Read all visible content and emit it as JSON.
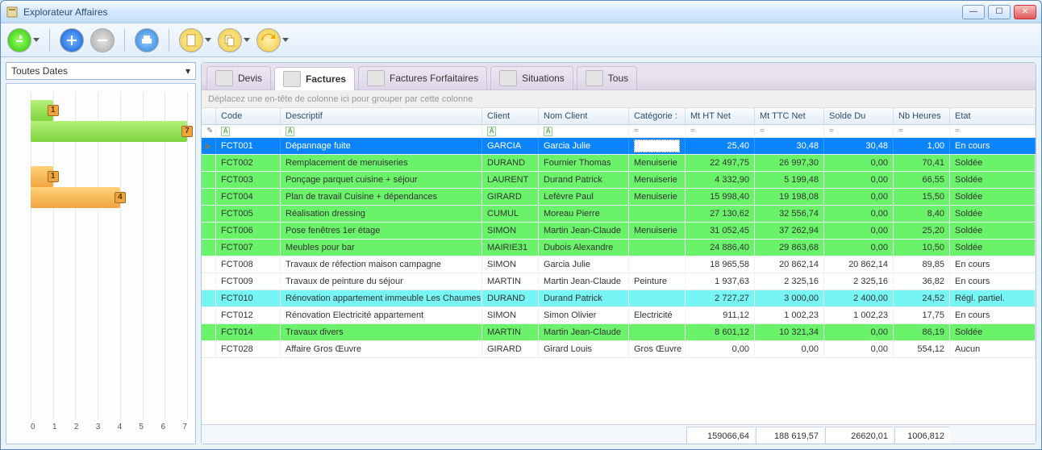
{
  "window": {
    "title": "Explorateur Affaires"
  },
  "date_filter": {
    "label": "Toutes Dates"
  },
  "chart_data": {
    "type": "bar",
    "xlim": [
      0,
      7
    ],
    "ticks": [
      "0",
      "1",
      "2",
      "3",
      "4",
      "5",
      "6",
      "7"
    ],
    "series": [
      {
        "name": "green-1",
        "value": 1,
        "label": "1"
      },
      {
        "name": "green-2",
        "value": 7,
        "label": "7"
      },
      {
        "name": "orange-1",
        "value": 1,
        "label": "1"
      },
      {
        "name": "orange-2",
        "value": 4,
        "label": "4"
      }
    ]
  },
  "tabs": [
    {
      "id": "devis",
      "label": "Devis"
    },
    {
      "id": "factures",
      "label": "Factures"
    },
    {
      "id": "forfait",
      "label": "Factures Forfaitaires"
    },
    {
      "id": "situations",
      "label": "Situations"
    },
    {
      "id": "tous",
      "label": "Tous"
    }
  ],
  "group_hint": "Déplacez une en-tête de colonne ici pour grouper par cette colonne",
  "columns": {
    "code": "Code",
    "descriptif": "Descriptif",
    "client": "Client",
    "nom_client": "Nom Client",
    "categorie": "Catégorie :",
    "ht": "Mt HT Net",
    "ttc": "Mt TTC Net",
    "solde": "Solde Du",
    "heures": "Nb Heures",
    "etat": "Etat"
  },
  "filter_glyph_text": "A",
  "filter_glyph_eq": "=",
  "rows": [
    {
      "sel": true,
      "st": "selected",
      "code": "FCT001",
      "desc": "Dépannage fuite",
      "client": "GARCIA",
      "nom": "Garcia Julie",
      "cat": "",
      "ht": "25,40",
      "ttc": "30,48",
      "solde": "30,48",
      "h": "1,00",
      "etat": "En cours",
      "cat_edit": true
    },
    {
      "st": "green",
      "code": "FCT002",
      "desc": "Remplacement de menuiseries",
      "client": "DURAND",
      "nom": "Fournier Thomas",
      "cat": "Menuiserie",
      "ht": "22 497,75",
      "ttc": "26 997,30",
      "solde": "0,00",
      "h": "70,41",
      "etat": "Soldée"
    },
    {
      "st": "green",
      "code": "FCT003",
      "desc": "Ponçage parquet cuisine + séjour",
      "client": "LAURENT",
      "nom": "Durand Patrick",
      "cat": "Menuiserie",
      "ht": "4 332,90",
      "ttc": "5 199,48",
      "solde": "0,00",
      "h": "66,55",
      "etat": "Soldée"
    },
    {
      "st": "green",
      "code": "FCT004",
      "desc": "Plan de travail Cuisine + dépendances",
      "client": "GIRARD",
      "nom": "Lefèvre Paul",
      "cat": "Menuiserie",
      "ht": "15 998,40",
      "ttc": "19 198,08",
      "solde": "0,00",
      "h": "15,50",
      "etat": "Soldée"
    },
    {
      "st": "green",
      "code": "FCT005",
      "desc": "Réalisation dressing",
      "client": "CUMUL",
      "nom": "Moreau Pierre",
      "cat": "",
      "ht": "27 130,62",
      "ttc": "32 556,74",
      "solde": "0,00",
      "h": "8,40",
      "etat": "Soldée"
    },
    {
      "st": "green",
      "code": "FCT006",
      "desc": "Pose fenêtres 1er étage",
      "client": "SIMON",
      "nom": "Martin Jean-Claude",
      "cat": "Menuiserie",
      "ht": "31 052,45",
      "ttc": "37 262,94",
      "solde": "0,00",
      "h": "25,20",
      "etat": "Soldée"
    },
    {
      "st": "green",
      "code": "FCT007",
      "desc": "Meubles pour bar",
      "client": "MAIRIE31",
      "nom": "Dubois Alexandre",
      "cat": "",
      "ht": "24 886,40",
      "ttc": "29 863,68",
      "solde": "0,00",
      "h": "10,50",
      "etat": "Soldée"
    },
    {
      "st": "white",
      "code": "FCT008",
      "desc": "Travaux de réfection maison campagne",
      "client": "SIMON",
      "nom": "Garcia Julie",
      "cat": "",
      "ht": "18 965,58",
      "ttc": "20 862,14",
      "solde": "20 862,14",
      "h": "89,85",
      "etat": "En cours"
    },
    {
      "st": "white",
      "code": "FCT009",
      "desc": "Travaux de peinture du séjour",
      "client": "MARTIN",
      "nom": "Martin Jean-Claude",
      "cat": "Peinture",
      "ht": "1 937,63",
      "ttc": "2 325,16",
      "solde": "2 325,16",
      "h": "36,82",
      "etat": "En cours"
    },
    {
      "st": "cyan",
      "code": "FCT010",
      "desc": "Rénovation appartement immeuble Les Chaumes",
      "client": "DURAND",
      "nom": "Durand Patrick",
      "cat": "",
      "ht": "2 727,27",
      "ttc": "3 000,00",
      "solde": "2 400,00",
      "h": "24,52",
      "etat": "Régl. partiel."
    },
    {
      "st": "white",
      "code": "FCT012",
      "desc": "Rénovation Electricité appartement",
      "client": "SIMON",
      "nom": "Simon Olivier",
      "cat": "Electricité",
      "ht": "911,12",
      "ttc": "1 002,23",
      "solde": "1 002,23",
      "h": "17,75",
      "etat": "En cours"
    },
    {
      "st": "green",
      "code": "FCT014",
      "desc": "Travaux divers",
      "client": "MARTIN",
      "nom": "Martin Jean-Claude",
      "cat": "",
      "ht": "8 601,12",
      "ttc": "10 321,34",
      "solde": "0,00",
      "h": "86,19",
      "etat": "Soldée"
    },
    {
      "st": "white",
      "code": "FCT028",
      "desc": "Affaire Gros Œuvre",
      "client": "GIRARD",
      "nom": "Girard Louis",
      "cat": "Gros Œuvre",
      "ht": "0,00",
      "ttc": "0,00",
      "solde": "0,00",
      "h": "554,12",
      "etat": "Aucun"
    }
  ],
  "totals": {
    "ht": "159066,64",
    "ttc": "188 619,57",
    "solde": "26620,01",
    "h": "1006,812"
  }
}
